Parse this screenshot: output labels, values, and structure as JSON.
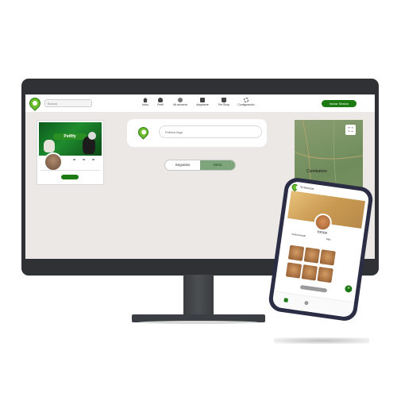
{
  "desktop": {
    "topbar": {
      "search_placeholder": "Buscar",
      "nav_items": [
        {
          "label": "Inicio",
          "icon": "home-icon"
        },
        {
          "label": "Perfil",
          "icon": "user-icon"
        },
        {
          "label": "Mi cercanía",
          "icon": "globe-icon"
        },
        {
          "label": "Adoptame",
          "icon": "adopt-icon"
        },
        {
          "label": "Pet Shop",
          "icon": "cart-icon"
        },
        {
          "label": "Configuración",
          "icon": "gear-icon"
        }
      ],
      "login_button": "Iniciar Sesion"
    },
    "profile_card": {
      "cover_title": "Petfify"
    },
    "composer": {
      "placeholder": "Publica Algo"
    },
    "toggle": {
      "left": "Seguidos",
      "right": "Otros"
    },
    "map": {
      "city_label": "Coimbatore"
    }
  },
  "phone": {
    "header": "Mi Mascota",
    "name": "Ionce",
    "stats": [
      {
        "label": "Seleccionado"
      },
      {
        "label": "Mas"
      }
    ]
  },
  "colors": {
    "accent": "#1d7a13",
    "screen_bg": "#ebe8e6",
    "toggle_active": "#7ea57b"
  }
}
